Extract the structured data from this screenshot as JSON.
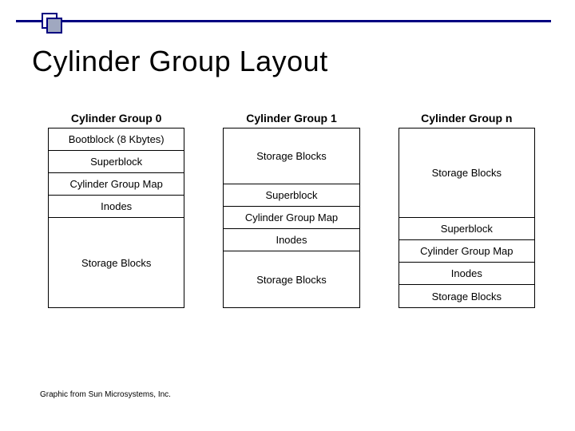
{
  "title": "Cylinder Group Layout",
  "attribution": "Graphic from Sun Microsystems, Inc.",
  "groups": [
    {
      "title": "Cylinder Group 0",
      "cells": [
        {
          "label": "Bootblock (8 Kbytes)",
          "hclass": "h1"
        },
        {
          "label": "Superblock",
          "hclass": "h2"
        },
        {
          "label": "Cylinder Group Map",
          "hclass": "h3"
        },
        {
          "label": "Inodes",
          "hclass": "h4"
        },
        {
          "label": "Storage Blocks",
          "hclass": "hbig"
        }
      ]
    },
    {
      "title": "Cylinder Group 1",
      "cells": [
        {
          "label": "Storage Blocks",
          "hclass": "hmed"
        },
        {
          "label": "Superblock",
          "hclass": "hsm"
        },
        {
          "label": "Cylinder Group Map",
          "hclass": "hsm"
        },
        {
          "label": "Inodes",
          "hclass": "hsm"
        },
        {
          "label": "Storage Blocks",
          "hclass": "hmed"
        }
      ]
    },
    {
      "title": "Cylinder Group n",
      "cells": [
        {
          "label": "Storage Blocks",
          "hclass": "hbig"
        },
        {
          "label": "Superblock",
          "hclass": "hsm"
        },
        {
          "label": "Cylinder Group Map",
          "hclass": "hsm"
        },
        {
          "label": "Inodes",
          "hclass": "hsm"
        },
        {
          "label": "Storage Blocks",
          "hclass": "hsm"
        }
      ]
    }
  ]
}
